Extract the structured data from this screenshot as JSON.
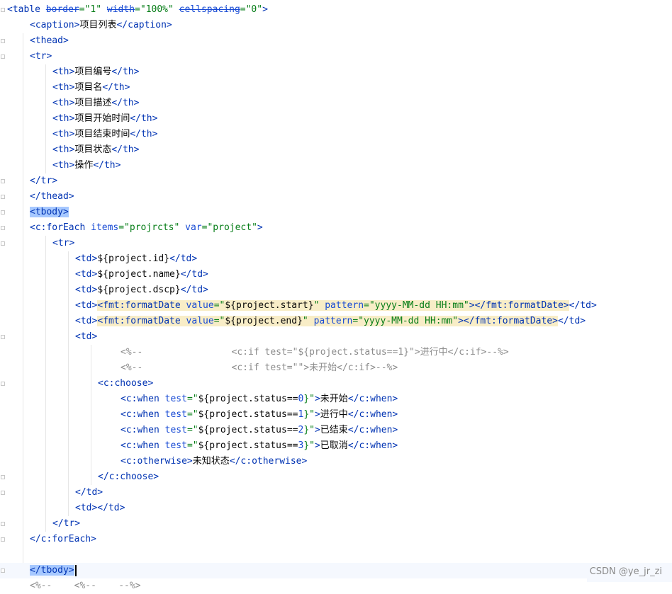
{
  "editor": {
    "lines": [
      {
        "segments": [
          {
            "t": "<table ",
            "c": "tag"
          },
          {
            "t": "border",
            "c": "strike"
          },
          {
            "t": "=\"1\" ",
            "c": "val"
          },
          {
            "t": "width",
            "c": "strike"
          },
          {
            "t": "=\"100%\" ",
            "c": "val"
          },
          {
            "t": "cellspacing",
            "c": "strike"
          },
          {
            "t": "=\"0\"",
            "c": "val"
          },
          {
            "t": ">",
            "c": "tag"
          }
        ]
      },
      {
        "segments": [
          {
            "t": "<caption>",
            "c": "tag"
          },
          {
            "t": "项目列表",
            "c": "txt"
          },
          {
            "t": "</caption>",
            "c": "tag"
          }
        ]
      },
      {
        "segments": [
          {
            "t": "<thead>",
            "c": "tag"
          }
        ]
      },
      {
        "segments": [
          {
            "t": "<tr>",
            "c": "tag"
          }
        ]
      },
      {
        "segments": [
          {
            "t": "<th>",
            "c": "tag"
          },
          {
            "t": "项目编号",
            "c": "txt"
          },
          {
            "t": "</th>",
            "c": "tag"
          }
        ]
      },
      {
        "segments": [
          {
            "t": "<th>",
            "c": "tag"
          },
          {
            "t": "项目名",
            "c": "txt"
          },
          {
            "t": "</th>",
            "c": "tag"
          }
        ]
      },
      {
        "segments": [
          {
            "t": "<th>",
            "c": "tag"
          },
          {
            "t": "项目描述",
            "c": "txt"
          },
          {
            "t": "</th>",
            "c": "tag"
          }
        ]
      },
      {
        "segments": [
          {
            "t": "<th>",
            "c": "tag"
          },
          {
            "t": "项目开始时间",
            "c": "txt"
          },
          {
            "t": "</th>",
            "c": "tag"
          }
        ]
      },
      {
        "segments": [
          {
            "t": "<th>",
            "c": "tag"
          },
          {
            "t": "项目结束时间",
            "c": "txt"
          },
          {
            "t": "</th>",
            "c": "tag"
          }
        ]
      },
      {
        "segments": [
          {
            "t": "<th>",
            "c": "tag"
          },
          {
            "t": "项目状态",
            "c": "txt"
          },
          {
            "t": "</th>",
            "c": "tag"
          }
        ]
      },
      {
        "segments": [
          {
            "t": "<th>",
            "c": "tag"
          },
          {
            "t": "操作",
            "c": "txt"
          },
          {
            "t": "</th>",
            "c": "tag"
          }
        ]
      },
      {
        "segments": [
          {
            "t": "</tr>",
            "c": "tag"
          }
        ]
      },
      {
        "segments": [
          {
            "t": "</thead>",
            "c": "tag"
          }
        ]
      },
      {
        "segments": [
          {
            "t": "<tbody>",
            "c": "tag tbody-hl"
          }
        ]
      },
      {
        "segments": [
          {
            "t": "<c:forEach ",
            "c": "tag"
          },
          {
            "t": "items",
            "c": "attr"
          },
          {
            "t": "=\"projrcts\" ",
            "c": "val"
          },
          {
            "t": "var",
            "c": "attr"
          },
          {
            "t": "=\"project\"",
            "c": "val"
          },
          {
            "t": ">",
            "c": "tag"
          }
        ]
      },
      {
        "segments": [
          {
            "t": "<tr>",
            "c": "tag"
          }
        ]
      },
      {
        "segments": [
          {
            "t": "<td>",
            "c": "tag"
          },
          {
            "t": "${project.id}",
            "c": "txt"
          },
          {
            "t": "</td>",
            "c": "tag"
          }
        ]
      },
      {
        "segments": [
          {
            "t": "<td>",
            "c": "tag"
          },
          {
            "t": "${project.name}",
            "c": "txt"
          },
          {
            "t": "</td>",
            "c": "tag"
          }
        ]
      },
      {
        "segments": [
          {
            "t": "<td>",
            "c": "tag"
          },
          {
            "t": "${project.dscp}",
            "c": "txt"
          },
          {
            "t": "</td>",
            "c": "tag"
          }
        ]
      },
      {
        "segments": [
          {
            "t": "<td>",
            "c": "tag"
          },
          {
            "t": "<fmt:formatDate ",
            "c": "el hl-yellow"
          },
          {
            "t": "value",
            "c": "attr hl-yellow"
          },
          {
            "t": "=\"",
            "c": "val hl-yellow"
          },
          {
            "t": "${project.start}",
            "c": "txt hl-yellow"
          },
          {
            "t": "\" ",
            "c": "val hl-yellow"
          },
          {
            "t": "pattern",
            "c": "attr hl-yellow"
          },
          {
            "t": "=\"yyyy-MM-dd HH:mm\"",
            "c": "val hl-yellow"
          },
          {
            "t": "></fmt:formatDate>",
            "c": "el hl-yellow"
          },
          {
            "t": "</td>",
            "c": "tag"
          }
        ]
      },
      {
        "segments": [
          {
            "t": "<td>",
            "c": "tag"
          },
          {
            "t": "<fmt:formatDate ",
            "c": "el hl-yellow"
          },
          {
            "t": "value",
            "c": "attr hl-yellow"
          },
          {
            "t": "=\"",
            "c": "val hl-yellow"
          },
          {
            "t": "${project.end}",
            "c": "txt hl-yellow"
          },
          {
            "t": "\" ",
            "c": "val hl-yellow"
          },
          {
            "t": "pattern",
            "c": "attr hl-yellow"
          },
          {
            "t": "=\"yyyy-MM-dd HH:mm\"",
            "c": "val hl-yellow"
          },
          {
            "t": "></fmt:formatDate>",
            "c": "el hl-yellow"
          },
          {
            "t": "</td>",
            "c": "tag"
          }
        ]
      },
      {
        "segments": [
          {
            "t": "<td>",
            "c": "tag"
          }
        ]
      },
      {
        "segments": [
          {
            "t": "<%--                <c:if test=\"${project.status==1}\">进行中</c:if>--%>",
            "c": "comment"
          }
        ]
      },
      {
        "segments": [
          {
            "t": "<%--                <c:if test=\"\">未开始</c:if>--%>",
            "c": "comment"
          }
        ]
      },
      {
        "segments": [
          {
            "t": "<c:choose>",
            "c": "tag"
          }
        ]
      },
      {
        "segments": [
          {
            "t": "<c:when ",
            "c": "tag"
          },
          {
            "t": "test",
            "c": "attr"
          },
          {
            "t": "=\"",
            "c": "val"
          },
          {
            "t": "${project.status==",
            "c": "txt"
          },
          {
            "t": "0",
            "c": "attr"
          },
          {
            "t": "}\"",
            "c": "val"
          },
          {
            "t": ">",
            "c": "tag"
          },
          {
            "t": "未开始",
            "c": "txt"
          },
          {
            "t": "</c:when>",
            "c": "tag"
          }
        ]
      },
      {
        "segments": [
          {
            "t": "<c:when ",
            "c": "tag"
          },
          {
            "t": "test",
            "c": "attr"
          },
          {
            "t": "=\"",
            "c": "val"
          },
          {
            "t": "${project.status==",
            "c": "txt"
          },
          {
            "t": "1",
            "c": "attr"
          },
          {
            "t": "}\"",
            "c": "val"
          },
          {
            "t": ">",
            "c": "tag"
          },
          {
            "t": "进行中",
            "c": "txt"
          },
          {
            "t": "</c:when>",
            "c": "tag"
          }
        ]
      },
      {
        "segments": [
          {
            "t": "<c:when ",
            "c": "tag"
          },
          {
            "t": "test",
            "c": "attr"
          },
          {
            "t": "=\"",
            "c": "val"
          },
          {
            "t": "${project.status==",
            "c": "txt"
          },
          {
            "t": "2",
            "c": "attr"
          },
          {
            "t": "}\"",
            "c": "val"
          },
          {
            "t": ">",
            "c": "tag"
          },
          {
            "t": "已结束",
            "c": "txt"
          },
          {
            "t": "</c:when>",
            "c": "tag"
          }
        ]
      },
      {
        "segments": [
          {
            "t": "<c:when ",
            "c": "tag"
          },
          {
            "t": "test",
            "c": "attr"
          },
          {
            "t": "=\"",
            "c": "val"
          },
          {
            "t": "${project.status==",
            "c": "txt"
          },
          {
            "t": "3",
            "c": "attr"
          },
          {
            "t": "}\"",
            "c": "val"
          },
          {
            "t": ">",
            "c": "tag"
          },
          {
            "t": "已取消",
            "c": "txt"
          },
          {
            "t": "</c:when>",
            "c": "tag"
          }
        ]
      },
      {
        "segments": [
          {
            "t": "<c:otherwise>",
            "c": "tag"
          },
          {
            "t": "未知状态",
            "c": "txt"
          },
          {
            "t": "</c:otherwise>",
            "c": "tag"
          }
        ]
      },
      {
        "segments": [
          {
            "t": "</c:choose>",
            "c": "tag"
          }
        ]
      },
      {
        "segments": [
          {
            "t": "</td>",
            "c": "tag"
          }
        ]
      },
      {
        "segments": [
          {
            "t": "<td></td>",
            "c": "tag"
          }
        ]
      },
      {
        "segments": [
          {
            "t": "</tr>",
            "c": "tag"
          }
        ]
      },
      {
        "segments": [
          {
            "t": "</c:forEach>",
            "c": "tag"
          }
        ]
      },
      {
        "segments": []
      },
      {
        "segments": [
          {
            "t": "</tbody>",
            "c": "tag tbody-hl"
          }
        ]
      },
      {
        "segments": [
          {
            "t": "<%--    <%--    --%>",
            "c": "comment"
          }
        ]
      }
    ]
  },
  "watermark": {
    "text": "CSDN @ye_jr_zi"
  }
}
